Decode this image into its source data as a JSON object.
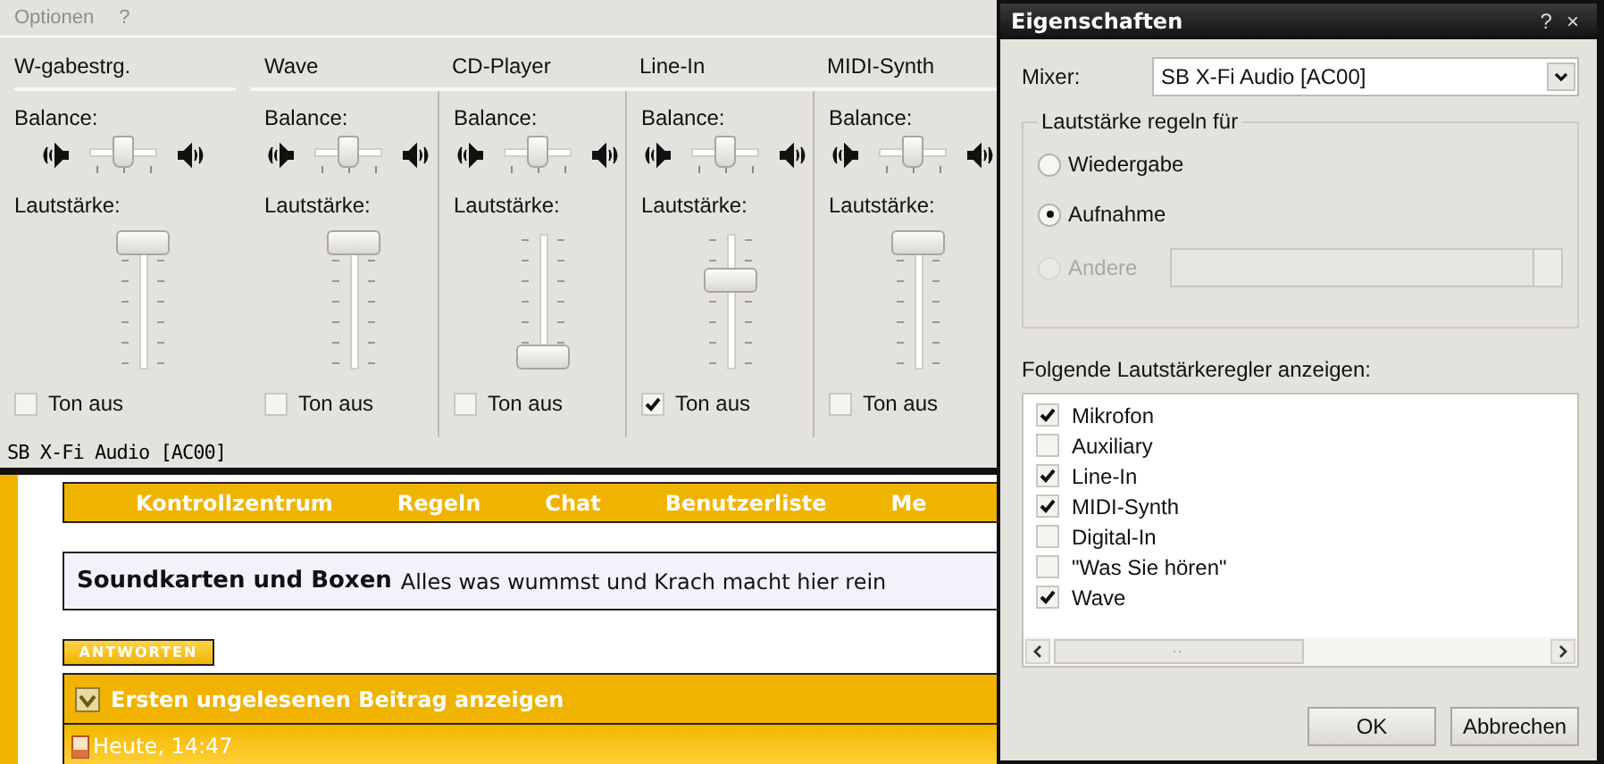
{
  "mixer": {
    "menu": [
      {
        "label": "Optionen",
        "disabled": true
      },
      {
        "label": "?",
        "disabled": true
      }
    ],
    "channels": [
      {
        "name": "W-gabestrg.",
        "balance_label": "Balance:",
        "balance": {
          "level": 0.5
        },
        "volume_label": "Lautstärke:",
        "volume": {
          "level": 1
        },
        "mute_label": "Ton aus",
        "muted": false
      },
      {
        "name": "Wave",
        "balance_label": "Balance:",
        "balance": {
          "level": 0.5
        },
        "volume_label": "Lautstärke:",
        "volume": {
          "level": 1
        },
        "mute_label": "Ton aus",
        "muted": false
      },
      {
        "name": "CD-Player",
        "balance_label": "Balance:",
        "balance": {
          "level": 0.5
        },
        "volume_label": "Lautstärke:",
        "volume": {
          "level": 0.03
        },
        "mute_label": "Ton aus",
        "muted": false
      },
      {
        "name": "Line-In",
        "balance_label": "Balance:",
        "balance": {
          "level": 0.5
        },
        "volume_label": "Lautstärke:",
        "volume": {
          "level": 0.68
        },
        "mute_label": "Ton aus",
        "muted": true
      },
      {
        "name": "MIDI-Synth",
        "balance_label": "Balance:",
        "balance": {
          "level": 0.5
        },
        "volume_label": "Lautstärke:",
        "volume": {
          "level": 1
        },
        "mute_label": "Ton aus",
        "muted": false
      }
    ],
    "status_bar": "SB X-Fi Audio [AC00]"
  },
  "forum": {
    "nav": [
      "Kontrollzentrum",
      "Regeln",
      "Chat",
      "Benutzerliste",
      "Me"
    ],
    "forum_title": "Soundkarten und Boxen",
    "forum_description": "Alles was wummst und Krach macht hier rein",
    "reply_button": "ANTWORTEN",
    "unread_link": "Ersten ungelesenen Beitrag anzeigen",
    "post_date": "Heute, 14:47"
  },
  "dialog": {
    "title": "Eigenschaften",
    "help": "?",
    "close": "×",
    "mixer_label": "Mixer:",
    "mixer_value": "SB X-Fi Audio [AC00]",
    "group_title": "Lautstärke regeln für",
    "modes": [
      {
        "label": "Wiedergabe",
        "selected": false,
        "disabled": false
      },
      {
        "label": "Aufnahme",
        "selected": true,
        "disabled": false
      },
      {
        "label": "Andere",
        "selected": false,
        "disabled": true
      }
    ],
    "list_label": "Folgende Lautstärkeregler anzeigen:",
    "controls": [
      {
        "label": "Mikrofon",
        "checked": true
      },
      {
        "label": "Auxiliary",
        "checked": false
      },
      {
        "label": "Line-In",
        "checked": true
      },
      {
        "label": "MIDI-Synth",
        "checked": true
      },
      {
        "label": "Digital-In",
        "checked": false
      },
      {
        "label": "\"Was Sie hören\"",
        "checked": false
      },
      {
        "label": "Wave",
        "checked": true
      }
    ],
    "buttons": [
      "OK",
      "Abbrechen"
    ]
  }
}
